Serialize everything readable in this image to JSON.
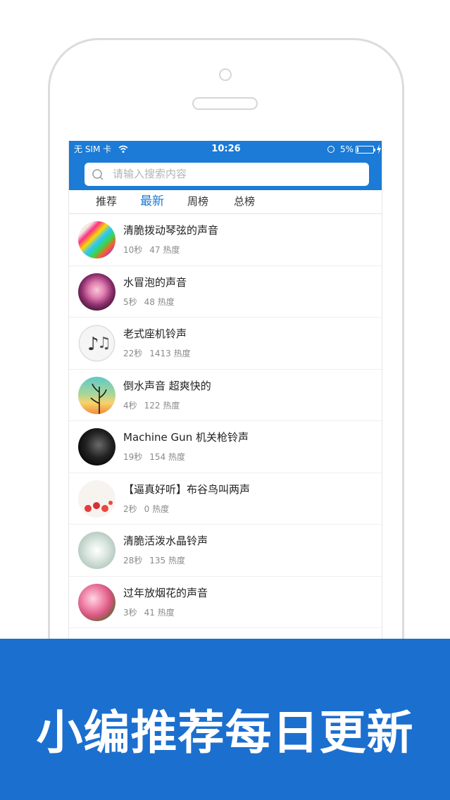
{
  "status_bar": {
    "carrier": "无 SIM 卡",
    "time": "10:26",
    "battery": "5%"
  },
  "search": {
    "placeholder": "请输入搜索内容"
  },
  "tabs": [
    {
      "label": "推荐",
      "active": false
    },
    {
      "label": "最新",
      "active": true
    },
    {
      "label": "周榜",
      "active": false
    },
    {
      "label": "总榜",
      "active": false
    }
  ],
  "sounds": [
    {
      "title": "清脆拨动琴弦的声音",
      "duration": "10秒",
      "heat": "47 热度",
      "thumb": "rainbow-strings"
    },
    {
      "title": "水冒泡的声音",
      "duration": "5秒",
      "heat": "48 热度",
      "thumb": "pink-hair-girl"
    },
    {
      "title": "老式座机铃声",
      "duration": "22秒",
      "heat": "1413 热度",
      "thumb": "music-notes"
    },
    {
      "title": "倒水声音 超爽快的",
      "duration": "4秒",
      "heat": "122 热度",
      "thumb": "sunset-plant"
    },
    {
      "title": "Machine Gun 机关枪铃声",
      "duration": "19秒",
      "heat": "154 热度",
      "thumb": "dark-album"
    },
    {
      "title": "【逼真好听】布谷鸟叫两声",
      "duration": "2秒",
      "heat": "0 热度",
      "thumb": "strawberries"
    },
    {
      "title": "清脆活泼水晶铃声",
      "duration": "28秒",
      "heat": "135 热度",
      "thumb": "girl-dress"
    },
    {
      "title": "过年放烟花的声音",
      "duration": "3秒",
      "heat": "41 热度",
      "thumb": "pink-blossoms"
    }
  ],
  "banner": {
    "text": "小编推荐每日更新"
  },
  "colors": {
    "accent": "#1b7bd6",
    "banner": "#1b6fcf"
  }
}
